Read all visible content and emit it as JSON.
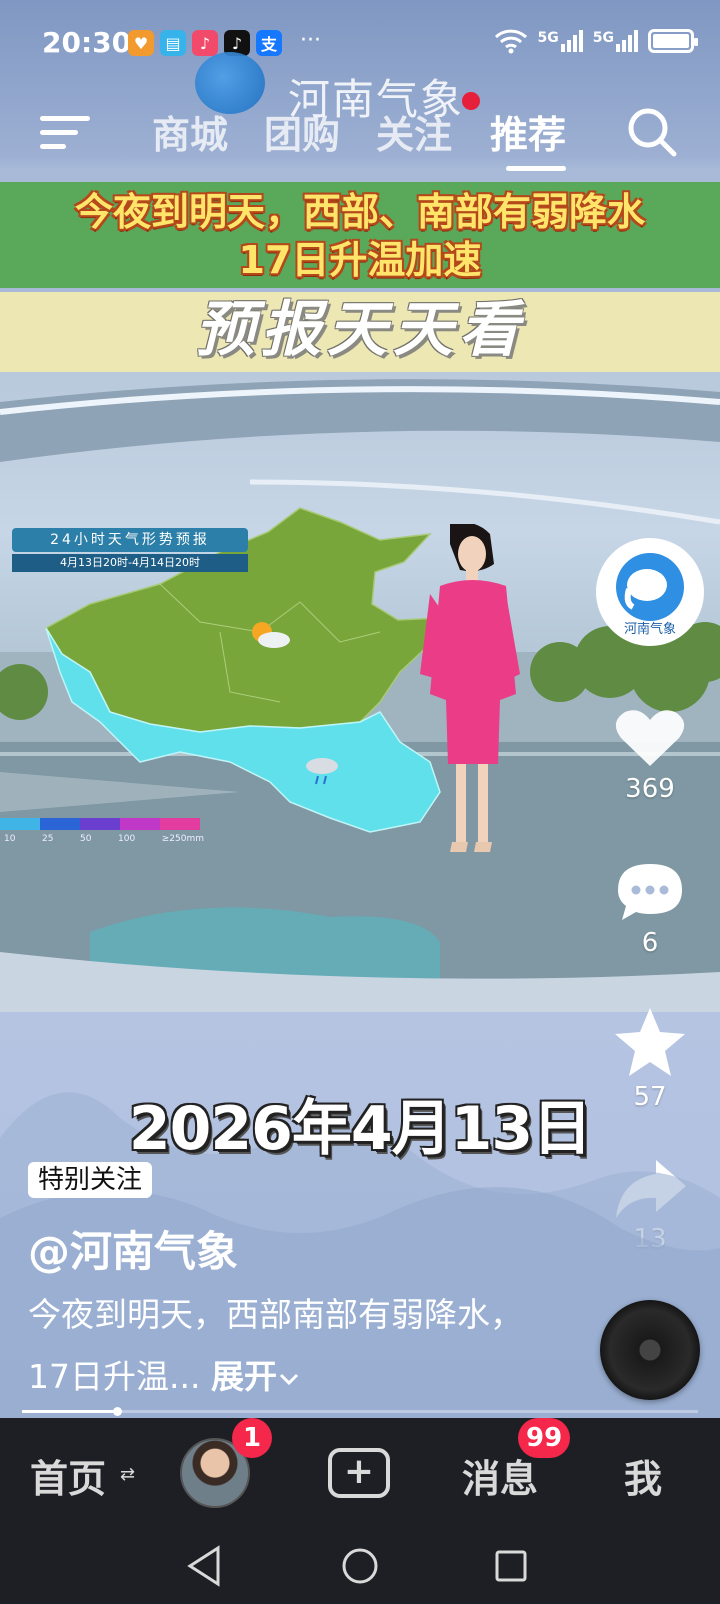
{
  "status_bar": {
    "time": "20:30",
    "network_1": "5G",
    "network_2": "5G"
  },
  "top_nav": {
    "tabs": [
      "商城",
      "团购",
      "关注",
      "推荐"
    ],
    "active_tab": "推荐",
    "watermark_text": "河南气象"
  },
  "video": {
    "headline_line1": "今夜到明天，西部、南部有弱降水",
    "headline_line2": "17日升温加速",
    "banner": "预报天天看",
    "map_title": "24小时天气形势预报",
    "map_subtitle": "4月13日20时-4月14日20时",
    "rain_scale": [
      "10",
      "25",
      "50",
      "100",
      "≥250mm"
    ],
    "date_overlay": "2026年4月13日",
    "account_logo_text": "河南气象"
  },
  "side_rail": {
    "likes": "369",
    "comments": "6",
    "favorites": "57",
    "shares": "13"
  },
  "post": {
    "badge": "特别关注",
    "author": "@河南气象",
    "description": "今夜到明天，西部南部有弱降水，17日升温...",
    "expand_label": "展开",
    "progress_fraction": 0.14
  },
  "tab_bar": {
    "home": "首页",
    "friends_badge": "1",
    "messages": "消息",
    "messages_badge": "99",
    "me": "我"
  },
  "colors": {
    "headline_bg": "#5aa95b",
    "headline_text": "#ffe66a",
    "badge_red": "#f5274a",
    "map_green": "#79a63a",
    "map_rain": "#5fe0ea",
    "presenter_pink": "#ea3c87"
  }
}
